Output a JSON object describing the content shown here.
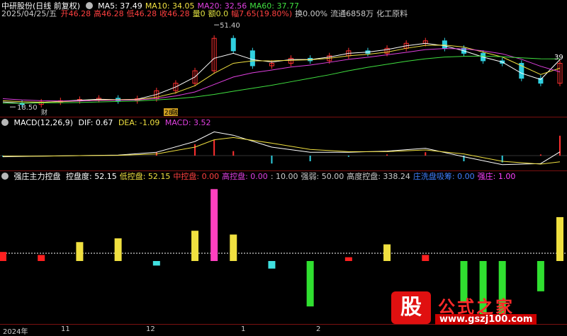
{
  "header": {
    "stock_title": "中研股份(日线 前复权)",
    "ma_labels": [
      {
        "text": "MA5: 37.49",
        "color": "#ffffff"
      },
      {
        "text": "MA10: 34.05",
        "color": "#f0e040"
      },
      {
        "text": "MA20: 32.56",
        "color": "#e040e0"
      },
      {
        "text": "MA60: 37.77",
        "color": "#40e040"
      }
    ],
    "date": "2025/04/25/五",
    "quote_items": [
      {
        "text": "开46.28",
        "color": "#ff4040"
      },
      {
        "text": "高46.28",
        "color": "#ff4040"
      },
      {
        "text": "低46.28",
        "color": "#ff4040"
      },
      {
        "text": "收46.28",
        "color": "#ff4040"
      },
      {
        "text": "量0",
        "color": "#e0e040"
      },
      {
        "text": "额0.0",
        "color": "#e0e040"
      },
      {
        "text": "幅7.65(19.80%)",
        "color": "#ff4040"
      },
      {
        "text": "换0.00%",
        "color": "#cccccc"
      },
      {
        "text": "流通6858万",
        "color": "#cccccc"
      },
      {
        "text": "化工原料",
        "color": "#cccccc"
      }
    ],
    "high_marker": "51.40",
    "low_marker": "18.50",
    "right_price": "39",
    "badge_cai": "财",
    "badge_num": "28",
    "badge_text": "融"
  },
  "macd": {
    "title": "MACD(12,26,9)",
    "dif": "DIF: 0.67",
    "dea": "DEA: -1.09",
    "macd": "MACD: 3.52"
  },
  "control": {
    "title": "强庄主力控盘",
    "items": [
      {
        "text": "控盘度: 52.15",
        "color": "#ffffff"
      },
      {
        "text": "低控盘: 52.15",
        "color": "#f0e040"
      },
      {
        "text": "中控盘: 0.00",
        "color": "#ff4040"
      },
      {
        "text": "高控盘: 0.00",
        "color": "#e040e0"
      },
      {
        "text": ": 10.00",
        "color": "#cccccc"
      },
      {
        "text": "强弱: 50.00",
        "color": "#cccccc"
      },
      {
        "text": "高度控盘: 338.24",
        "color": "#cccccc"
      },
      {
        "text": "庄洗盘吸筹: 0.00",
        "color": "#4080ff"
      },
      {
        "text": "强庄: 1.00",
        "color": "#ff40ff"
      }
    ]
  },
  "xaxis": {
    "labels": [
      "2024年",
      "11",
      "12",
      "1",
      "2"
    ]
  },
  "logo": {
    "badge": "股",
    "name": "公式之家",
    "url": "www.gszj100.com"
  },
  "chart_data": [
    {
      "type": "line",
      "title": "K线",
      "x": [
        0,
        5,
        10,
        15,
        20,
        25,
        30,
        35,
        40,
        45,
        50,
        55,
        60,
        65,
        70,
        75,
        80,
        85,
        90,
        95,
        100,
        105,
        110,
        115,
        120,
        125,
        130,
        135,
        140,
        145
      ],
      "series": [
        {
          "name": "Close",
          "values": [
            20,
            19.5,
            20.5,
            21,
            21.5,
            22,
            21,
            21.8,
            25,
            28,
            33,
            46,
            41,
            35,
            36,
            38,
            37,
            39,
            41,
            40,
            42,
            44,
            45,
            42,
            40,
            37,
            36,
            30,
            28,
            36
          ]
        },
        {
          "name": "MA5",
          "values": [
            20.5,
            20,
            20.3,
            20.8,
            21.2,
            21.6,
            21.4,
            21.6,
            23.5,
            26.5,
            30.5,
            38,
            40,
            37.5,
            36.5,
            37.5,
            37.5,
            38.5,
            40,
            40.5,
            41.5,
            43,
            44,
            43,
            41,
            38.5,
            36.5,
            32,
            29.5,
            37.49
          ]
        },
        {
          "name": "MA10",
          "values": [
            21,
            20.6,
            20.4,
            20.6,
            20.9,
            21.3,
            21.4,
            21.5,
            22.4,
            24.2,
            27,
            32,
            36,
            37,
            37,
            37.2,
            37.4,
            38,
            39,
            39.6,
            40.5,
            42,
            43.2,
            43.3,
            42.5,
            40.5,
            38.5,
            35,
            31.5,
            34.05
          ]
        },
        {
          "name": "MA20",
          "values": [
            21.8,
            21.3,
            21,
            20.9,
            20.9,
            21.1,
            21.2,
            21.3,
            21.9,
            22.9,
            24.5,
            27.5,
            30.5,
            32.2,
            33.3,
            34.5,
            35.3,
            36.4,
            37.6,
            38.4,
            39.4,
            40.4,
            41.5,
            41.9,
            41.8,
            41,
            39.8,
            37.6,
            34.8,
            32.56
          ]
        },
        {
          "name": "MA60",
          "values": [
            20,
            20,
            20.1,
            20.2,
            20.3,
            20.5,
            20.7,
            20.9,
            21.3,
            21.8,
            22.5,
            23.5,
            24.8,
            26,
            27.2,
            28.6,
            30,
            31.4,
            33,
            34.4,
            35.6,
            36.8,
            37.8,
            38.5,
            38.8,
            38.9,
            38.6,
            38.2,
            37.8,
            37.77
          ]
        }
      ],
      "ylim": [
        16,
        54
      ]
    },
    {
      "type": "line",
      "title": "MACD(12,26,9)",
      "x": [
        0,
        10,
        20,
        30,
        40,
        50,
        55,
        60,
        70,
        80,
        90,
        100,
        110,
        120,
        130,
        140,
        145
      ],
      "series": [
        {
          "name": "DIF",
          "values": [
            -0.2,
            -0.1,
            0,
            0.1,
            0.6,
            2.5,
            4.2,
            3.6,
            1.5,
            0.6,
            0.6,
            0.8,
            1.3,
            -0.2,
            -1.6,
            -1.4,
            0.67
          ]
        },
        {
          "name": "DEA",
          "values": [
            -0.1,
            -0.1,
            0,
            0.05,
            0.3,
            1.5,
            2.8,
            3.2,
            2.2,
            1.1,
            0.7,
            0.7,
            1.0,
            0.3,
            -1.0,
            -1.5,
            -1.09
          ]
        },
        {
          "name": "MACD",
          "values": [
            -0.2,
            0,
            0,
            0.1,
            0.6,
            2.0,
            2.8,
            0.8,
            -1.4,
            -1.0,
            -0.2,
            0.2,
            0.6,
            -1.0,
            -1.2,
            0.2,
            3.52
          ]
        }
      ],
      "ylim": [
        -2.5,
        5
      ]
    },
    {
      "type": "bar",
      "title": "强庄主力控盘",
      "x": [
        0,
        10,
        20,
        30,
        40,
        50,
        55,
        60,
        70,
        80,
        90,
        100,
        110,
        120,
        125,
        130,
        140,
        145
      ],
      "series": [
        {
          "name": "控盘度",
          "values": [
            12,
            8,
            25,
            30,
            -6,
            40,
            95,
            35,
            -10,
            -60,
            5,
            22,
            8,
            -55,
            -80,
            -70,
            -40,
            58
          ]
        }
      ],
      "ylim": [
        -90,
        100
      ]
    }
  ]
}
